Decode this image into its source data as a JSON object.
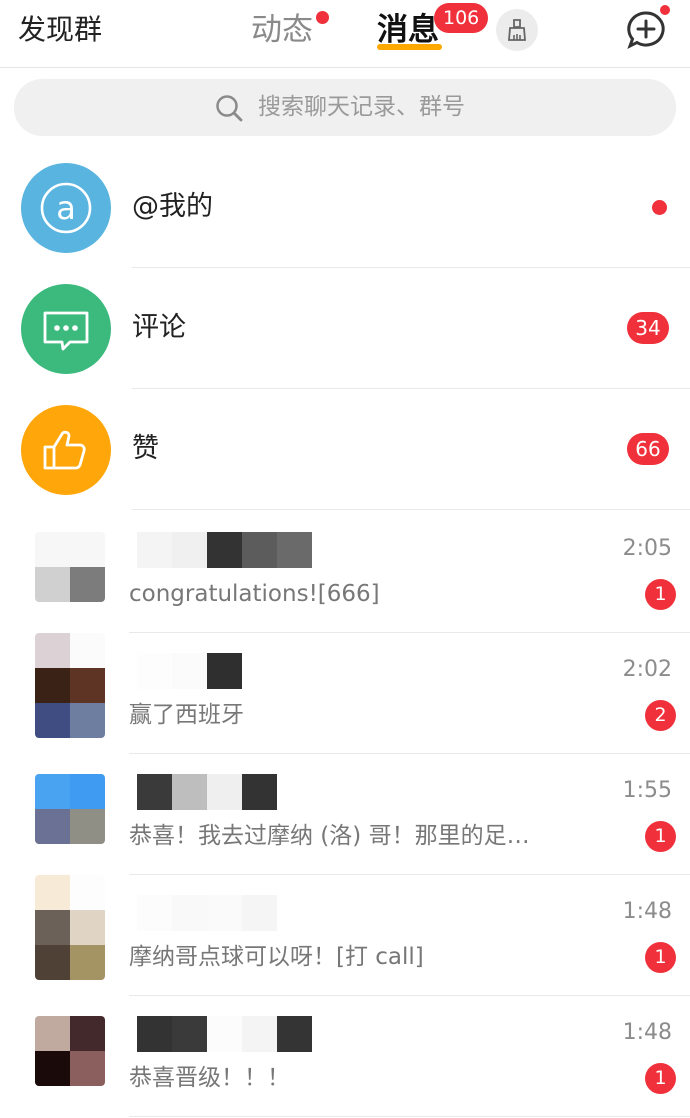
{
  "topbar": {
    "left_label": "发现群",
    "tab_dynamic": "动态",
    "tab_messages": "消息",
    "messages_badge": "106",
    "clean_icon": "broom-icon",
    "add_icon": "add-chat-icon"
  },
  "search": {
    "icon": "search-icon",
    "placeholder": "搜索聊天记录、群号"
  },
  "special": [
    {
      "title": "@我的",
      "icon": "at-icon",
      "color": "#5ab4e0",
      "badge": ""
    },
    {
      "title": "评论",
      "icon": "comment-icon",
      "color": "#3cba7e",
      "badge": "34"
    },
    {
      "title": "赞",
      "icon": "thumbs-up-icon",
      "color": "#ffa60a",
      "badge": "66"
    }
  ],
  "chats": [
    {
      "time": "2:05",
      "preview": "congratulations![666]",
      "count": "1"
    },
    {
      "time": "2:02",
      "preview": "赢了西班牙",
      "count": "2"
    },
    {
      "time": "1:55",
      "preview": "恭喜！我去过摩纳 (洛) 哥！那里的足…",
      "count": "1"
    },
    {
      "time": "1:48",
      "preview": "摩纳哥点球可以呀！[打 call]",
      "count": "1"
    },
    {
      "time": "1:48",
      "preview": "恭喜晋级！！！",
      "count": "1"
    }
  ],
  "colors": {
    "accent_red": "#f0303a",
    "tab_underline": "#ffa800"
  }
}
